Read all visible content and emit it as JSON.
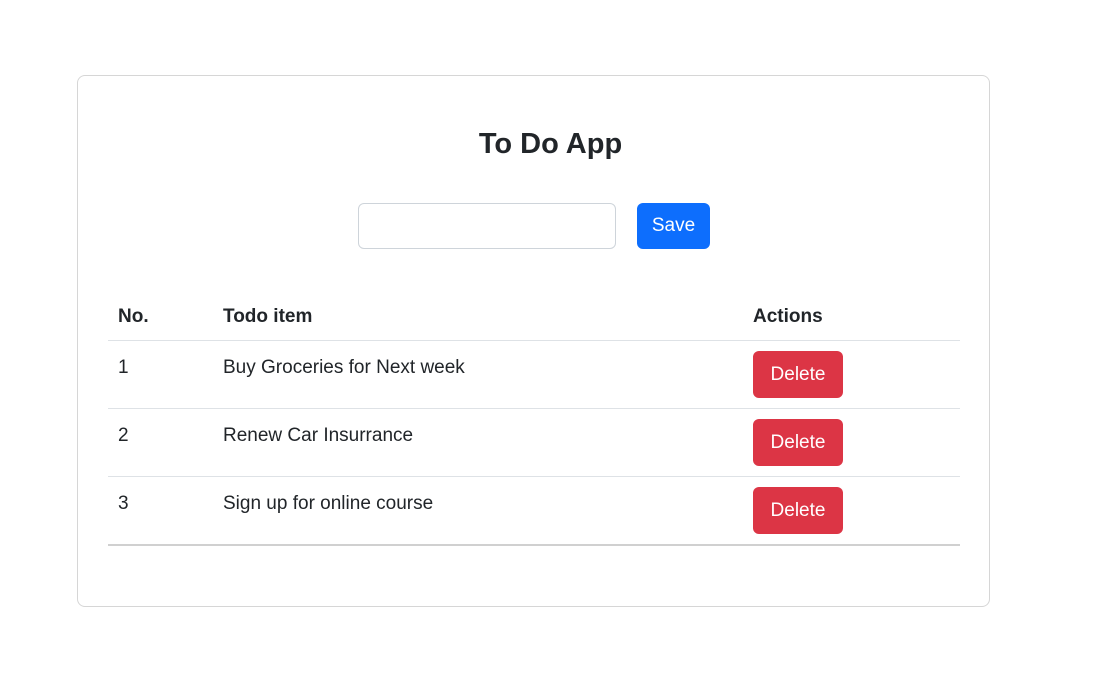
{
  "title": "To Do App",
  "input": {
    "value": "",
    "placeholder": ""
  },
  "save_label": "Save",
  "table": {
    "headers": [
      "No.",
      "Todo item",
      "Actions"
    ],
    "rows": [
      {
        "no": "1",
        "item": "Buy Groceries for Next week",
        "action": "Delete"
      },
      {
        "no": "2",
        "item": "Renew Car Insurrance",
        "action": "Delete"
      },
      {
        "no": "3",
        "item": "Sign up for online course",
        "action": "Delete"
      }
    ]
  },
  "colors": {
    "primary": "#0d6efd",
    "danger": "#dc3545"
  }
}
